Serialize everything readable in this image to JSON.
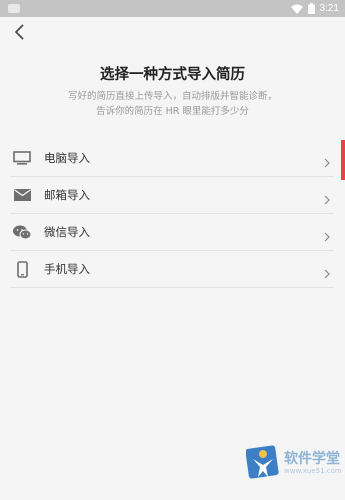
{
  "status_bar": {
    "time": "3:21"
  },
  "page": {
    "title": "选择一种方式导入简历",
    "subtitle_line1": "写好的简历直接上传导入，自动排版并智能诊断，",
    "subtitle_line2": "告诉你的简历在 HR 眼里能打多少分"
  },
  "menu": {
    "items": [
      {
        "label": "电脑导入",
        "icon": "computer-icon"
      },
      {
        "label": "邮箱导入",
        "icon": "mail-icon"
      },
      {
        "label": "微信导入",
        "icon": "wechat-icon"
      },
      {
        "label": "手机导入",
        "icon": "phone-icon"
      }
    ]
  },
  "watermark": {
    "text": "软件学堂",
    "sub": "www.xue51.com"
  },
  "colors": {
    "accent_edge": "#e04848",
    "icon_gray": "#6e6e6e",
    "watermark": "#8fb4d8"
  }
}
